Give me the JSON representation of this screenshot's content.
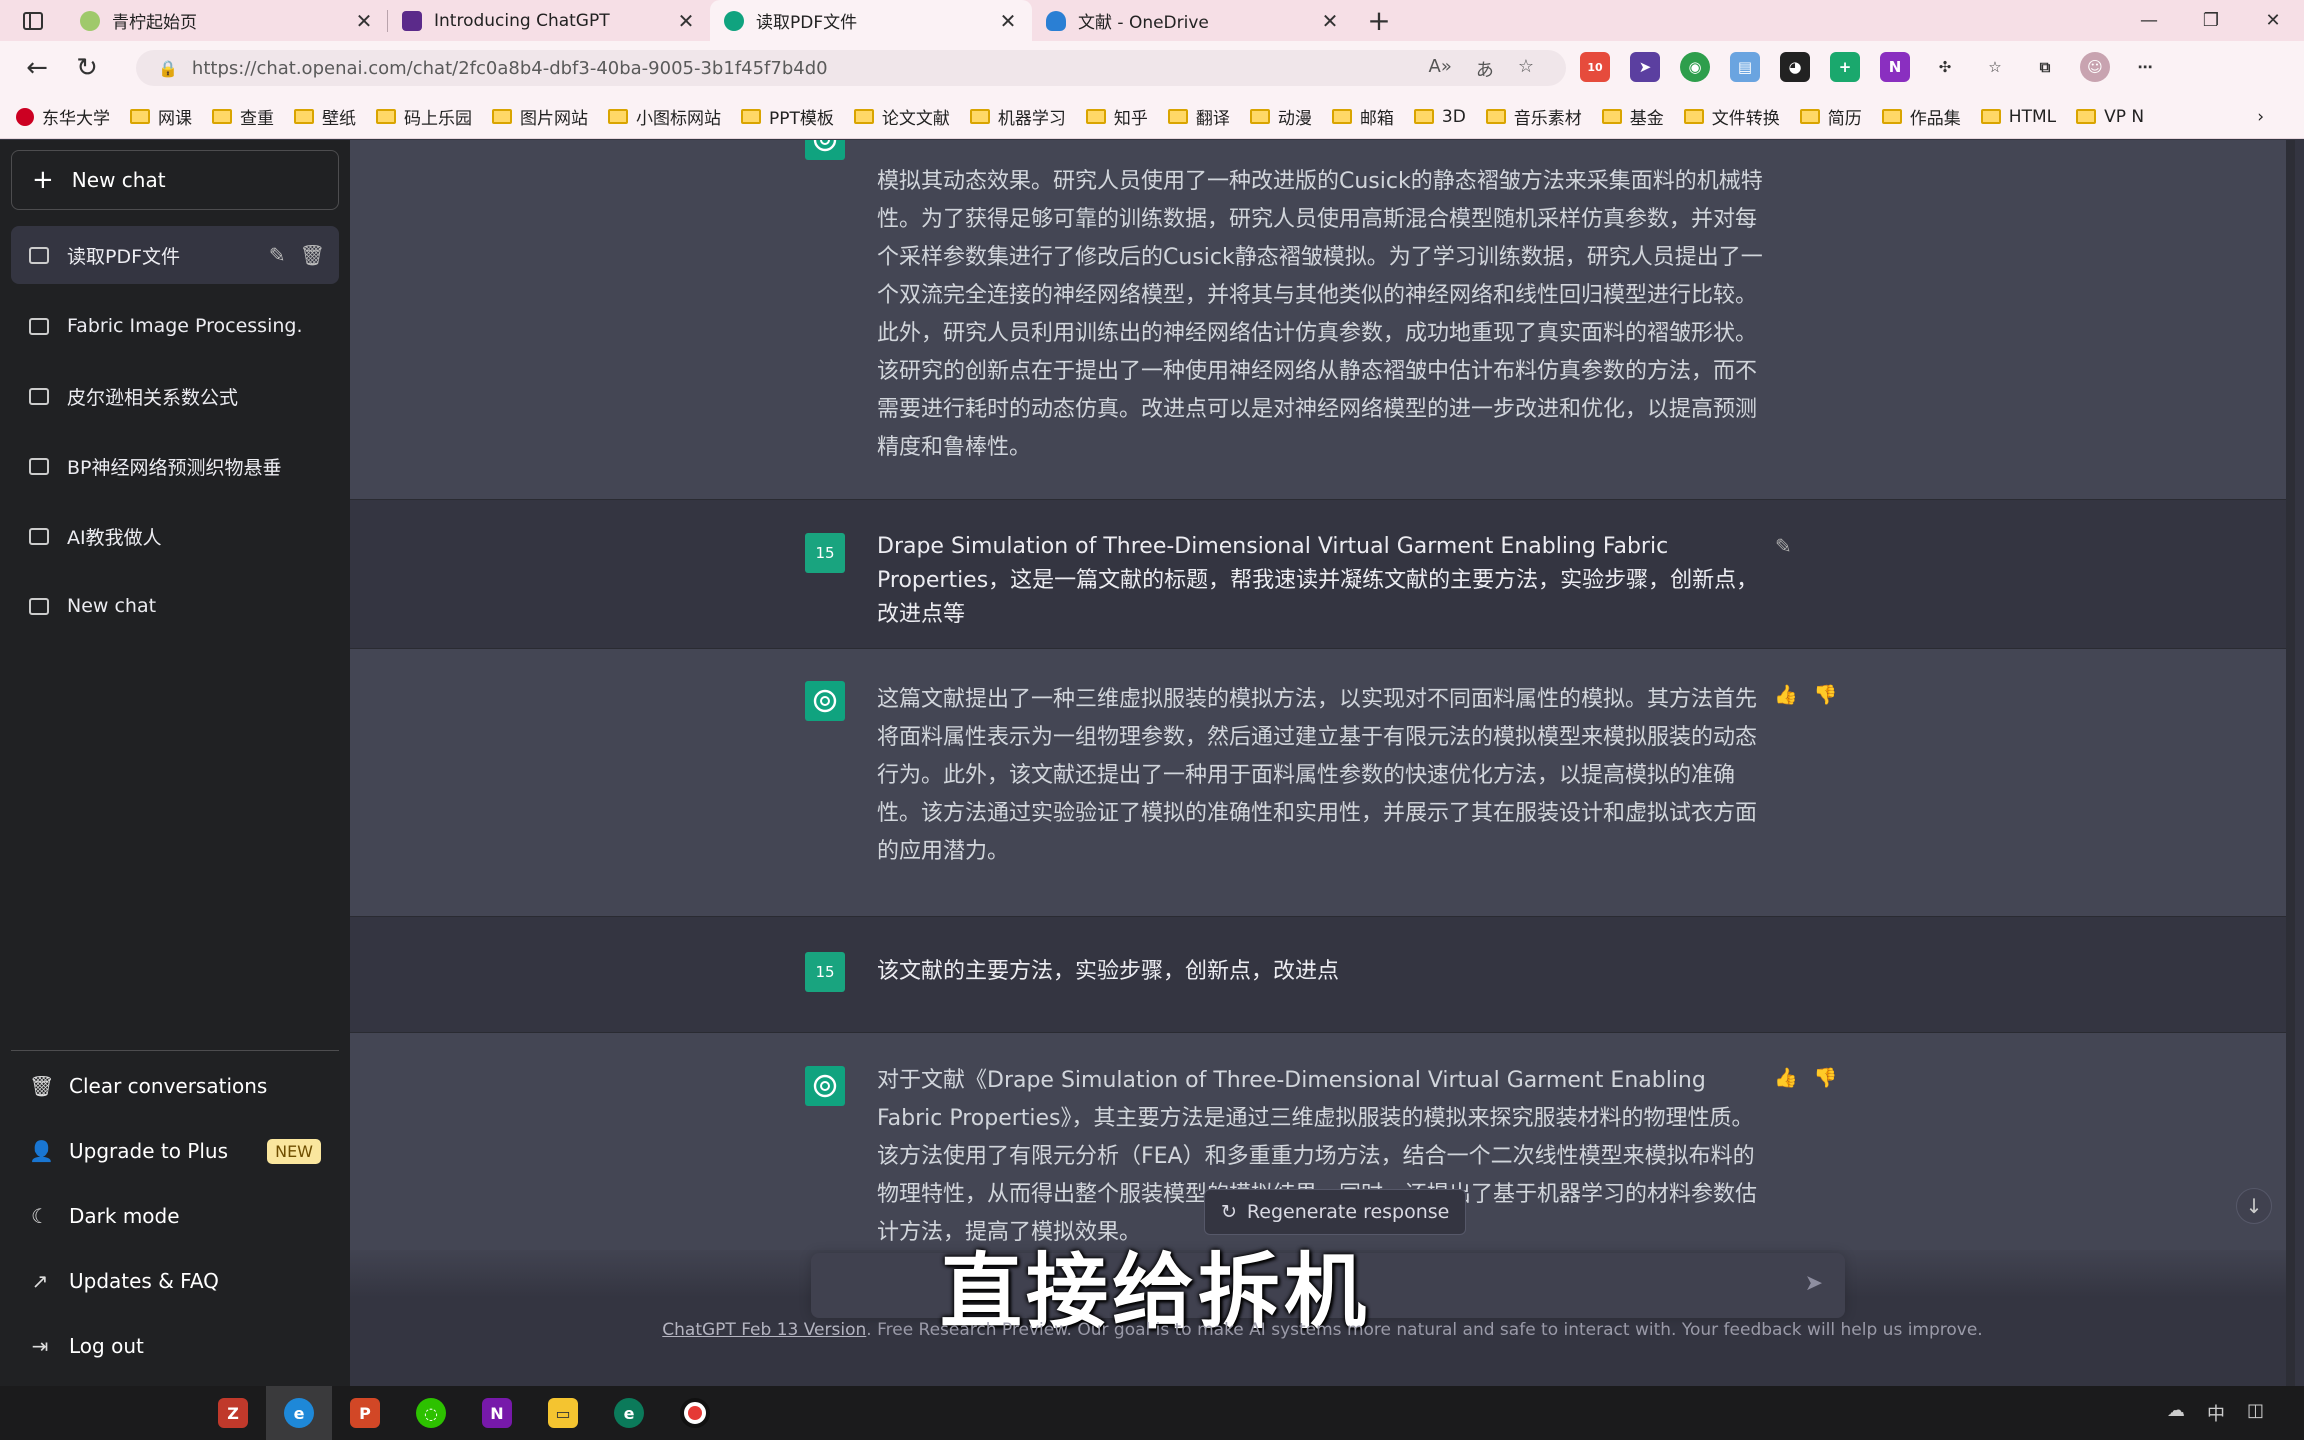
{
  "browser": {
    "tabs": [
      {
        "label": "青柠起始页",
        "color": "#9fc96b"
      },
      {
        "label": "Introducing ChatGPT",
        "color": "#5b2a8a"
      },
      {
        "label": "读取PDF文件",
        "color": "#10a37f"
      },
      {
        "label": "文献 - OneDrive",
        "color": "#2a7fd4"
      }
    ],
    "url": "https://chat.openai.com/chat/2fc0a8b4-dbf3-40ba-9005-3b1f45f7b4d0",
    "ext_badge": "10",
    "bookmarks": [
      "东华大学",
      "网课",
      "查重",
      "壁纸",
      "码上乐园",
      "图片网站",
      "小图标网站",
      "PPT模板",
      "论文文献",
      "机器学习",
      "知乎",
      "翻译",
      "动漫",
      "邮箱",
      "3D",
      "音乐素材",
      "基金",
      "文件转换",
      "简历",
      "作品集",
      "HTML",
      "VP N"
    ]
  },
  "sidebar": {
    "new_chat": "New chat",
    "conversations": [
      "读取PDF文件",
      "Fabric Image Processing.",
      "皮尔逊相关系数公式",
      "BP神经网络预测织物悬垂",
      "AI教我做人",
      "New chat"
    ],
    "menu": {
      "clear": "Clear conversations",
      "upgrade": "Upgrade to Plus",
      "upgrade_badge": "NEW",
      "dark": "Dark mode",
      "updates": "Updates & FAQ",
      "logout": "Log out"
    }
  },
  "chat": {
    "user_avatar": "15",
    "messages": [
      {
        "role": "assistant",
        "text": "模拟其动态效果。研究人员使用了一种改进版的Cusick的静态褶皱方法来采集面料的机械特性。为了获得足够可靠的训练数据，研究人员使用高斯混合模型随机采样仿真参数，并对每个采样参数集进行了修改后的Cusick静态褶皱模拟。为了学习训练数据，研究人员提出了一个双流完全连接的神经网络模型，并将其与其他类似的神经网络和线性回归模型进行比较。此外，研究人员利用训练出的神经网络估计仿真参数，成功地重现了真实面料的褶皱形状。该研究的创新点在于提出了一种使用神经网络从静态褶皱中估计布料仿真参数的方法，而不需要进行耗时的动态仿真。改进点可以是对神经网络模型的进一步改进和优化，以提高预测精度和鲁棒性。"
      },
      {
        "role": "user",
        "text": "Drape Simulation of Three-Dimensional Virtual Garment Enabling Fabric Properties，这是一篇文献的标题，帮我速读并凝练文献的主要方法，实验步骤，创新点，改进点等"
      },
      {
        "role": "assistant",
        "text": "这篇文献提出了一种三维虚拟服装的模拟方法，以实现对不同面料属性的模拟。其方法首先将面料属性表示为一组物理参数，然后通过建立基于有限元法的模拟模型来模拟服装的动态行为。此外，该文献还提出了一种用于面料属性参数的快速优化方法，以提高模拟的准确性。该方法通过实验验证了模拟的准确性和实用性，并展示了其在服装设计和虚拟试衣方面的应用潜力。"
      },
      {
        "role": "user",
        "text": "该文献的主要方法，实验步骤，创新点，改进点"
      },
      {
        "role": "assistant",
        "text": "对于文献《Drape Simulation of Three-Dimensional Virtual Garment Enabling Fabric Properties》，其主要方法是通过三维虚拟服装的模拟来探究服装材料的物理性质。该方法使用了有限元分析（FEA）和多重重力场方法，结合一个二次线性模型来模拟布料的物理特性，从而得出整个服装模型的模拟结果。同时，还提出了基于机器学习的材料参数估计方法，提高了模拟效果。"
      }
    ],
    "regenerate": "Regenerate response",
    "input_placeholder": "",
    "subtitle": "直接给拆机",
    "footer_link": "ChatGPT Feb 13 Version",
    "footer_text": ". Free Research Preview. Our goal is to make AI systems more natural and safe to interact with. Your feedback will help us improve."
  }
}
